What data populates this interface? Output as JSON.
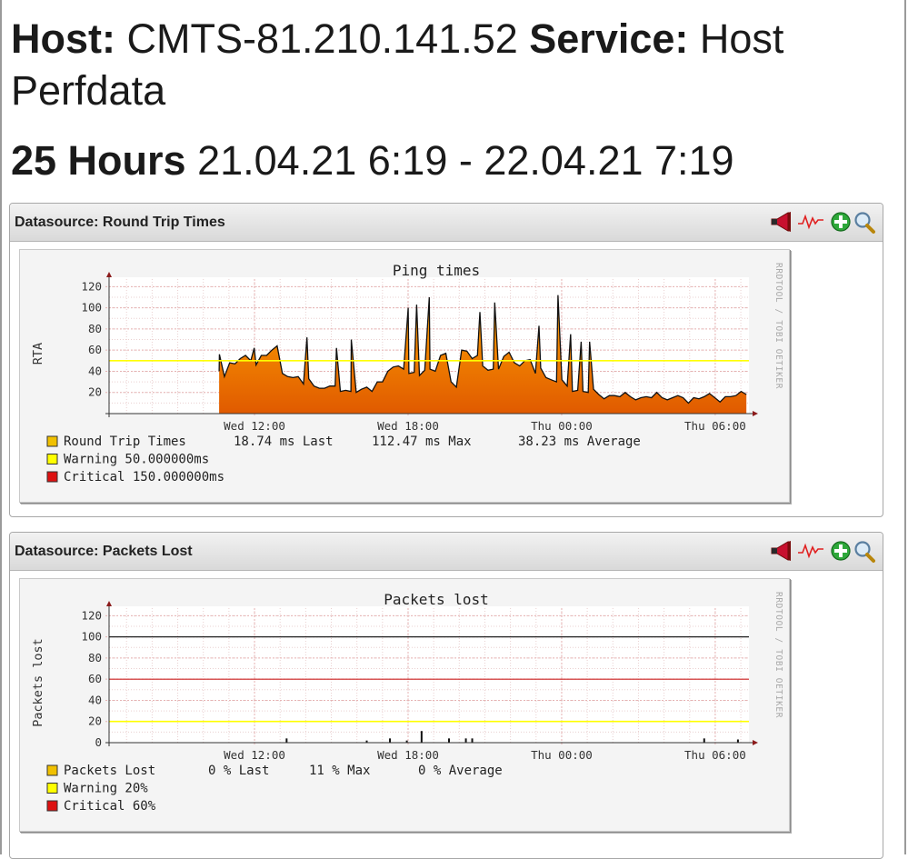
{
  "header": {
    "host_label": "Host:",
    "host_value": "CMTS-81.210.141.52",
    "service_label": "Service:",
    "service_value": "Host Perfdata",
    "range_label": "25 Hours",
    "range_value": "21.04.21 6:19 - 22.04.21 7:19"
  },
  "panels": [
    {
      "title": "Datasource: Round Trip Times",
      "icons": [
        "megaphone-icon",
        "graph-wave-icon",
        "add-icon",
        "zoom-icon"
      ]
    },
    {
      "title": "Datasource: Packets Lost",
      "icons": [
        "megaphone-icon",
        "graph-wave-icon",
        "add-icon",
        "zoom-icon"
      ]
    }
  ],
  "watermark": "RRDTOOL / TOBI OETIKER",
  "colors": {
    "series_top": "#ffa500",
    "series_bottom": "#e05a00",
    "warning": "#ffff00",
    "critical": "#ff0000",
    "grid": "#e6b3b3"
  },
  "chart_data": [
    {
      "type": "area",
      "title": "Ping times",
      "ylabel": "RTA",
      "xlabel": "",
      "ylim": [
        0,
        125
      ],
      "yticks": [
        20,
        40,
        60,
        80,
        100,
        120
      ],
      "xticks": [
        "Wed 12:00",
        "Wed 18:00",
        "Thu 00:00",
        "Thu 06:00"
      ],
      "grid": true,
      "x_hours": [
        0,
        0.5,
        1,
        1.5,
        2,
        2.5,
        3,
        3.5,
        4,
        4.5,
        5,
        5.5,
        6,
        6.5,
        7,
        7.5,
        8,
        8.5,
        9,
        9.5,
        10,
        10.5,
        11,
        11.5,
        12,
        12.5,
        13,
        13.5,
        14,
        14.5,
        15,
        15.5,
        16,
        16.5,
        17,
        17.5,
        18,
        18.5,
        19,
        19.5,
        20,
        20.5,
        21,
        21.5,
        22,
        22.5,
        23,
        23.5,
        24,
        24.5,
        25
      ],
      "series": [
        {
          "name": "Round Trip Times",
          "values": [
            40,
            48,
            52,
            50,
            55,
            60,
            38,
            34,
            28,
            26,
            24,
            26,
            22,
            20,
            25,
            30,
            40,
            45,
            38,
            36,
            42,
            55,
            30,
            60,
            52,
            45,
            42,
            54,
            48,
            50,
            38,
            34,
            30,
            26,
            22,
            20,
            18,
            17,
            16,
            16,
            15,
            15,
            15,
            15,
            15,
            15,
            16,
            15,
            16,
            17,
            18
          ],
          "spikes": [
            [
              0.05,
              56
            ],
            [
              1.7,
              62
            ],
            [
              4.2,
              72
            ],
            [
              5.6,
              62
            ],
            [
              6.3,
              70
            ],
            [
              9.0,
              100
            ],
            [
              9.4,
              103
            ],
            [
              10.0,
              110
            ],
            [
              12.4,
              96
            ],
            [
              13.1,
              105
            ],
            [
              15.2,
              83
            ],
            [
              16.1,
              112
            ],
            [
              16.7,
              75
            ],
            [
              17.2,
              68
            ],
            [
              17.6,
              68
            ]
          ],
          "legend_stats": {
            "last": "18.74 ms Last",
            "max": "112.47 ms Max",
            "average": "38.23 ms Average"
          }
        }
      ],
      "thresholds": [
        {
          "name": "Warning",
          "value": 50,
          "label": "50.000000ms"
        },
        {
          "name": "Critical",
          "value": 150,
          "label": "150.000000ms"
        }
      ]
    },
    {
      "type": "area",
      "title": "Packets lost",
      "ylabel": "Packets lost",
      "xlabel": "",
      "ylim": [
        0,
        125
      ],
      "yticks": [
        0,
        20,
        40,
        60,
        80,
        100,
        120
      ],
      "xticks": [
        "Wed 12:00",
        "Wed 18:00",
        "Thu 00:00",
        "Thu 06:00"
      ],
      "grid": true,
      "series": [
        {
          "name": "Packets Lost",
          "spikes": [
            [
              3.2,
              4
            ],
            [
              7.0,
              2
            ],
            [
              8.1,
              4
            ],
            [
              8.9,
              2
            ],
            [
              9.6,
              11
            ],
            [
              10.9,
              4
            ],
            [
              11.7,
              4
            ],
            [
              12.0,
              4
            ],
            [
              23.0,
              4
            ],
            [
              24.6,
              3
            ]
          ],
          "legend_stats": {
            "last": "0 % Last",
            "max": "11 % Max",
            "average": "0 % Average"
          }
        }
      ],
      "thresholds": [
        {
          "name": "Warning",
          "value": 20,
          "label": "20%"
        },
        {
          "name": "Critical",
          "value": 60,
          "label": "60%"
        },
        {
          "name": "",
          "value": 100,
          "label": ""
        }
      ]
    }
  ]
}
